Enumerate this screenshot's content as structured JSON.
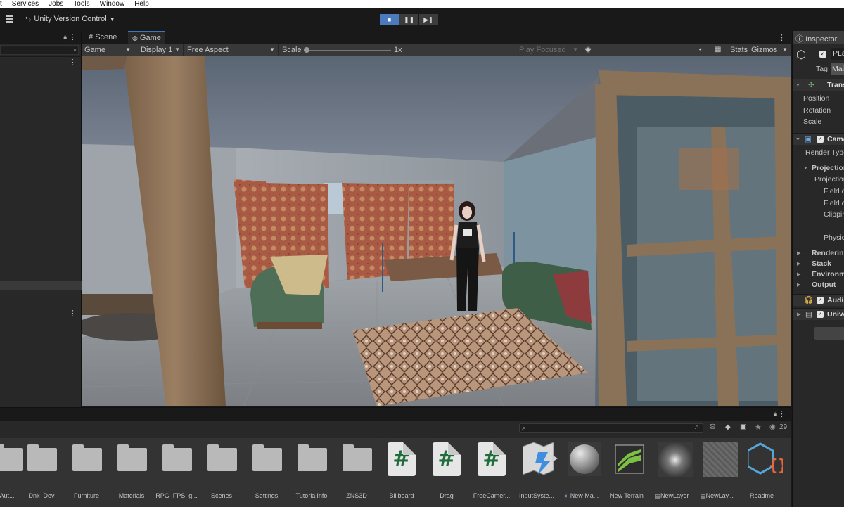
{
  "menu": [
    "t",
    "Services",
    "Jobs",
    "Tools",
    "Window",
    "Help"
  ],
  "toolbar": {
    "version_control": "Unity Version Control",
    "play_buttons": [
      "stop",
      "pause",
      "step"
    ]
  },
  "game_view": {
    "tabs": [
      {
        "label": "Scene"
      },
      {
        "label": "Game"
      }
    ],
    "mode": "Game",
    "display": "Display 1",
    "aspect": "Free Aspect",
    "scale_label": "Scale",
    "scale_value": "1x",
    "play_focused": "Play Focused",
    "stats": "Stats",
    "gizmos": "Gizmos"
  },
  "inspector": {
    "title": "Inspector",
    "object_name": "PLa",
    "tag_label": "Tag",
    "tag_value": "Mai",
    "transform": "Trans",
    "position": "Position",
    "rotation": "Rotation",
    "scale": "Scale",
    "camera": "Came",
    "render_type": "Render Type",
    "projection_header": "Projection",
    "projection": "Projection",
    "field_of": "Field o",
    "field_of2": "Field o",
    "clipping": "Clippin",
    "physical": "Physic",
    "rendering": "Rendering",
    "stack": "Stack",
    "environment": "Environme",
    "output": "Output",
    "audio": "Audio",
    "universal": "Unive"
  },
  "project": {
    "count": "29",
    "assets": [
      {
        "label": "Aut...",
        "kind": "folder"
      },
      {
        "label": "Dnk_Dev",
        "kind": "folder"
      },
      {
        "label": "Furniture",
        "kind": "folder"
      },
      {
        "label": "Materials",
        "kind": "folder"
      },
      {
        "label": "RPG_FPS_g...",
        "kind": "folder"
      },
      {
        "label": "Scenes",
        "kind": "folder"
      },
      {
        "label": "Settings",
        "kind": "folder"
      },
      {
        "label": "TutorialInfo",
        "kind": "folder"
      },
      {
        "label": "ZNS3D",
        "kind": "folder"
      },
      {
        "label": "Billboard",
        "kind": "script"
      },
      {
        "label": "Drag",
        "kind": "script"
      },
      {
        "label": "FreeCamer...",
        "kind": "script"
      },
      {
        "label": "InputSyste...",
        "kind": "input"
      },
      {
        "label": "New Ma...",
        "kind": "material"
      },
      {
        "label": "New Terrain",
        "kind": "terrain"
      },
      {
        "label": "NewLayer",
        "kind": "layer"
      },
      {
        "label": "NewLay...",
        "kind": "layer2"
      },
      {
        "label": "Readme",
        "kind": "readme"
      }
    ]
  },
  "colors": {
    "accent": "#3a79bb",
    "play_active": "#4c7abf",
    "panel_bg": "#282828",
    "script_green": "#1f6d3a"
  }
}
